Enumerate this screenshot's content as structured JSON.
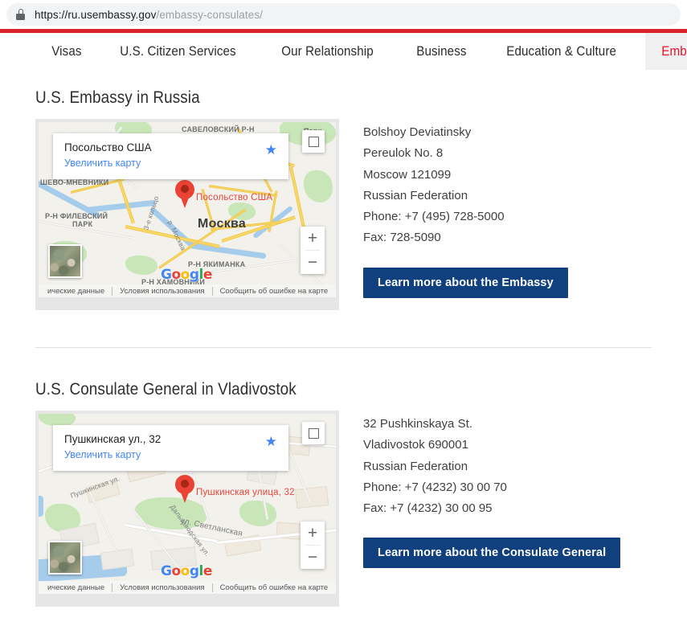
{
  "browser": {
    "lock_icon": "lock-icon",
    "url_domain": "https://ru.usembassy.gov",
    "url_path": "/embassy-consulates/"
  },
  "nav": {
    "items": [
      {
        "label": "Visas",
        "active": false
      },
      {
        "label": "U.S. Citizen Services",
        "active": false
      },
      {
        "label": "Our Relationship",
        "active": false
      },
      {
        "label": "Business",
        "active": false
      },
      {
        "label": "Education & Culture",
        "active": false
      },
      {
        "label": "Embassy & Consulates",
        "active": true
      }
    ],
    "accent_color": "#d8232a",
    "active_color": "#e8112d",
    "active_bg": "#f0f0f0"
  },
  "sections": [
    {
      "title": "U.S. Embassy in Russia",
      "map": {
        "card_title": "Посольство США",
        "card_link": "Увеличить карту",
        "star_icon": "star-icon",
        "marker_label": "Посольство США",
        "city_label": "Москва",
        "district_labels": [
          "САВЕЛОВСКИЙ Р-Н",
          "Парк",
          "ШЕВО-МНЕВНИКИ",
          "Р-Н ФИЛЕВСКИЙ",
          "ПАРК",
          "Р-Н ЯКИМАНКА",
          "Р-Н ХАМОВНИКИ"
        ],
        "road_labels": [
          "3-е кольцо",
          "р. Москва"
        ],
        "zoom_in": "+",
        "zoom_out": "−",
        "logo": "Google",
        "attribution": [
          "ические данные",
          "Условия использования",
          "Сообщить об ошибке на карте"
        ]
      },
      "address": [
        "Bolshoy Deviatinsky",
        "Pereulok No. 8",
        "Moscow 121099",
        "Russian Federation",
        "Phone: +7 (495) 728-5000",
        "Fax: 728-5090"
      ],
      "button_label": "Learn more about the Embassy",
      "button_color": "#11407f"
    },
    {
      "title": "U.S. Consulate General in Vladivostok",
      "map": {
        "card_title": "Пушкинская ул., 32",
        "card_link": "Увеличить карту",
        "star_icon": "star-icon",
        "marker_label": "Пушкинская улица, 32",
        "city_label": "",
        "district_labels": [],
        "road_labels": [
          "Пушкинская ул.",
          "ул. Светланская",
          "Дальзаводская ул."
        ],
        "zoom_in": "+",
        "zoom_out": "−",
        "logo": "Google",
        "attribution": [
          "ические данные",
          "Условия использования",
          "Сообщить об ошибке на карте"
        ]
      },
      "address": [
        "32 Pushkinskaya St.",
        "Vladivostok 690001",
        "Russian Federation",
        "Phone: +7 (4232) 30 00 70",
        "Fax: +7 (4232) 30 00 95"
      ],
      "button_label": "Learn more about the Consulate General",
      "button_color": "#11407f"
    }
  ]
}
